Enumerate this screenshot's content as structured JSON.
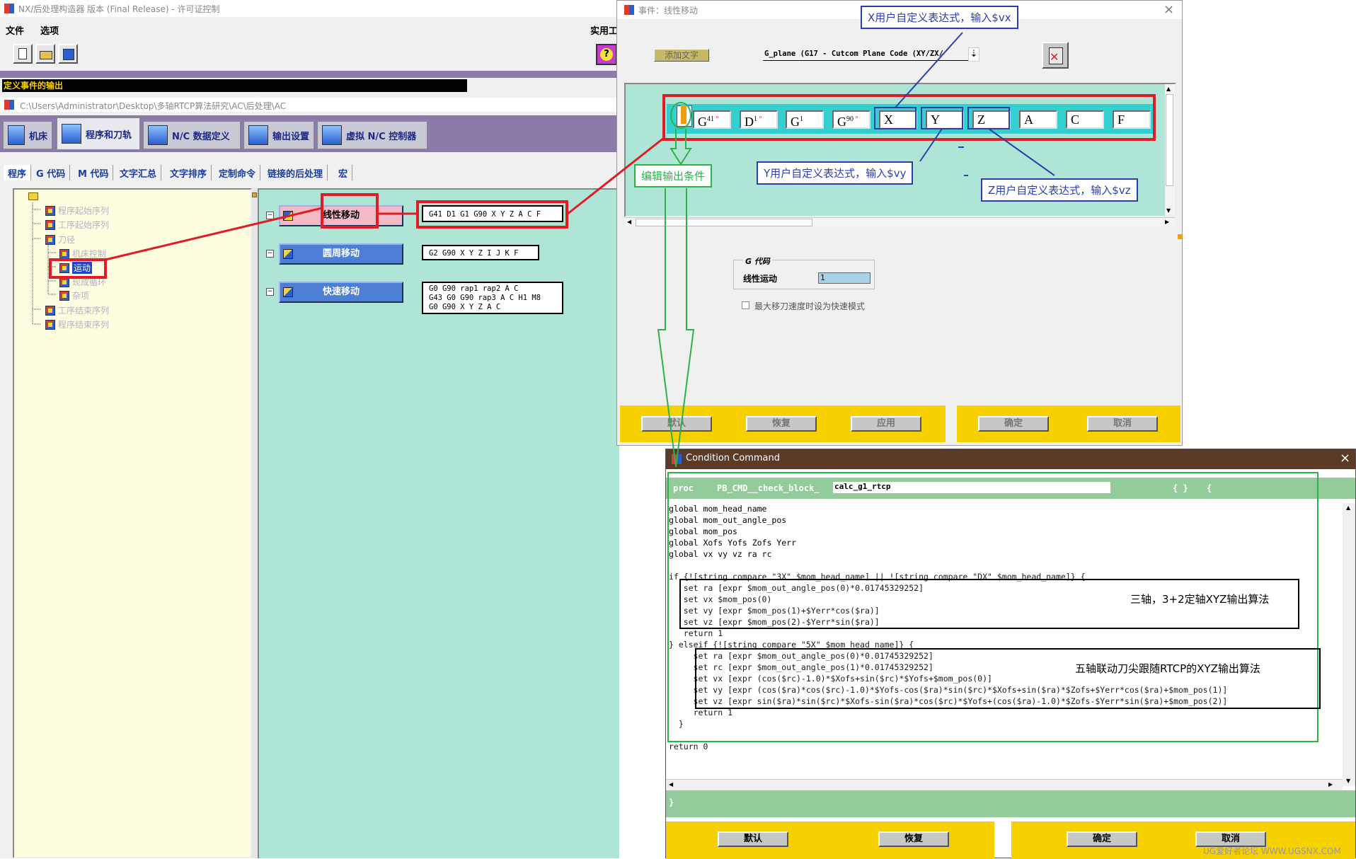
{
  "left_window": {
    "title": "NX/后处理构造器 版本 (Final Release) - 许可证控制",
    "menu": [
      "文件",
      "选项"
    ],
    "menu_right": "实用工",
    "event_output_bar": "定义事件的输出",
    "path": "C:\\Users\\Administrator\\Desktop\\多轴RTCP算法研究\\AC\\后处理\\AC",
    "main_tabs": [
      "机床",
      "程序和刀轨",
      "N/C 数据定义",
      "输出设置",
      "虚拟 N/C 控制器"
    ],
    "sub_tabs": [
      "程序",
      "G 代码",
      "M 代码",
      "文字汇总",
      "文字排序",
      "定制命令",
      "链接的后处理",
      "宏"
    ],
    "tree": [
      {
        "label": "程序起始序列"
      },
      {
        "label": "工序起始序列"
      },
      {
        "label": "刀径"
      },
      {
        "label": "机床控制"
      },
      {
        "label": "运动"
      },
      {
        "label": "现成循环"
      },
      {
        "label": "杂项"
      },
      {
        "label": "工序结束序列"
      },
      {
        "label": "程序结束序列"
      }
    ],
    "events": [
      {
        "label": "线性移动",
        "code": "G41 D1 G1 G90 X Y Z A C F"
      },
      {
        "label": "圆周移动",
        "code": "G2 G90 X Y Z I J K F"
      },
      {
        "label": "快速移动",
        "code": "G0 G90 rap1 rap2 A C\nG43 G0 G90 rap3 A C H1 M8\nG0 G90 X Y Z A C"
      }
    ]
  },
  "event_dialog": {
    "title": "事件：线性移动",
    "add_word_label": "添加文字",
    "select_value": "G_plane (G17 - Cutcom Plane Code (XY/ZX/",
    "tokens": [
      {
        "main": "G",
        "sub": "41"
      },
      {
        "main": "D",
        "sub": "1"
      },
      {
        "main": "G",
        "sub": "1"
      },
      {
        "main": "G",
        "sub": "90"
      },
      {
        "main": "X",
        "sub": ""
      },
      {
        "main": "Y",
        "sub": ""
      },
      {
        "main": "Z",
        "sub": ""
      },
      {
        "main": "A",
        "sub": ""
      },
      {
        "main": "C",
        "sub": ""
      },
      {
        "main": "F",
        "sub": ""
      }
    ],
    "group_title": "G 代码",
    "field_label": "线性运动",
    "field_value": "1",
    "checkbox_label": "最大移刀速度时设为快速模式",
    "buttons_left": [
      "默认",
      "恢复",
      "应用"
    ],
    "buttons_right": [
      "确定",
      "取消"
    ]
  },
  "condition_dialog": {
    "title": "Condition Command",
    "proc_keyword": "proc",
    "proc_prefix": "PB_CMD__check_block_",
    "proc_name": "calc_g1_rtcp",
    "proc_braces": "{ }",
    "proc_open": "{",
    "code_lines": [
      "global mom_head_name",
      "global mom_out_angle_pos",
      "global mom_pos",
      "global Xofs Yofs Zofs Yerr",
      "global vx vy vz ra rc",
      "",
      "if {![string compare \"3X\" $mom_head_name] || ![string compare \"DX\" $mom_head_name]} {",
      "   set ra [expr $mom_out_angle_pos(0)*0.01745329252]",
      "   set vx $mom_pos(0)",
      "   set vy [expr $mom_pos(1)+$Yerr*cos($ra)]",
      "   set vz [expr $mom_pos(2)-$Yerr*sin($ra)]",
      "   return 1",
      "} elseif {![string compare \"5X\" $mom_head_name]} {",
      "     set ra [expr $mom_out_angle_pos(0)*0.01745329252]",
      "     set rc [expr $mom_out_angle_pos(1)*0.01745329252]",
      "     set vx [expr (cos($rc)-1.0)*$Xofs+sin($rc)*$Yofs+$mom_pos(0)]",
      "     set vy [expr (cos($ra)*cos($rc)-1.0)*$Yofs-cos($ra)*sin($rc)*$Xofs+sin($ra)*$Zofs+$Yerr*cos($ra)+$mom_pos(1)]",
      "     set vz [expr sin($ra)*sin($rc)*$Xofs-sin($ra)*cos($rc)*$Yofs+(cos($ra)-1.0)*$Zofs-$Yerr*sin($ra)+$mom_pos(2)]",
      "     return 1",
      "  }",
      "",
      "return 0"
    ],
    "closing_brace": "}",
    "buttons_left": [
      "默认",
      "恢复"
    ],
    "buttons_right": [
      "确定",
      "取消"
    ]
  },
  "annotations": {
    "x_expr": "X用户自定义表达式，输入$vx",
    "y_expr": "Y用户自定义表达式，输入$vy",
    "z_expr": "Z用户自定义表达式，输入$vz",
    "edit_condition": "编辑输出条件",
    "three_axis": "三轴，3+2定轴XYZ输出算法",
    "five_axis": "五轴联动刀尖跟随RTCP的XYZ输出算法"
  },
  "watermark": "UG爱好者论坛 WWW.UGSNX.COM",
  "colors": {
    "teal_bg": "#aee5d6",
    "purple_bar": "#8c7aa8",
    "tree_bg": "#fffde0",
    "yellow": "#f7d000",
    "red_highlight": "#e01c24",
    "blue_callout": "#2c3fa8",
    "green_callout": "#2db24a",
    "code_header_green": "#93cc9a"
  }
}
